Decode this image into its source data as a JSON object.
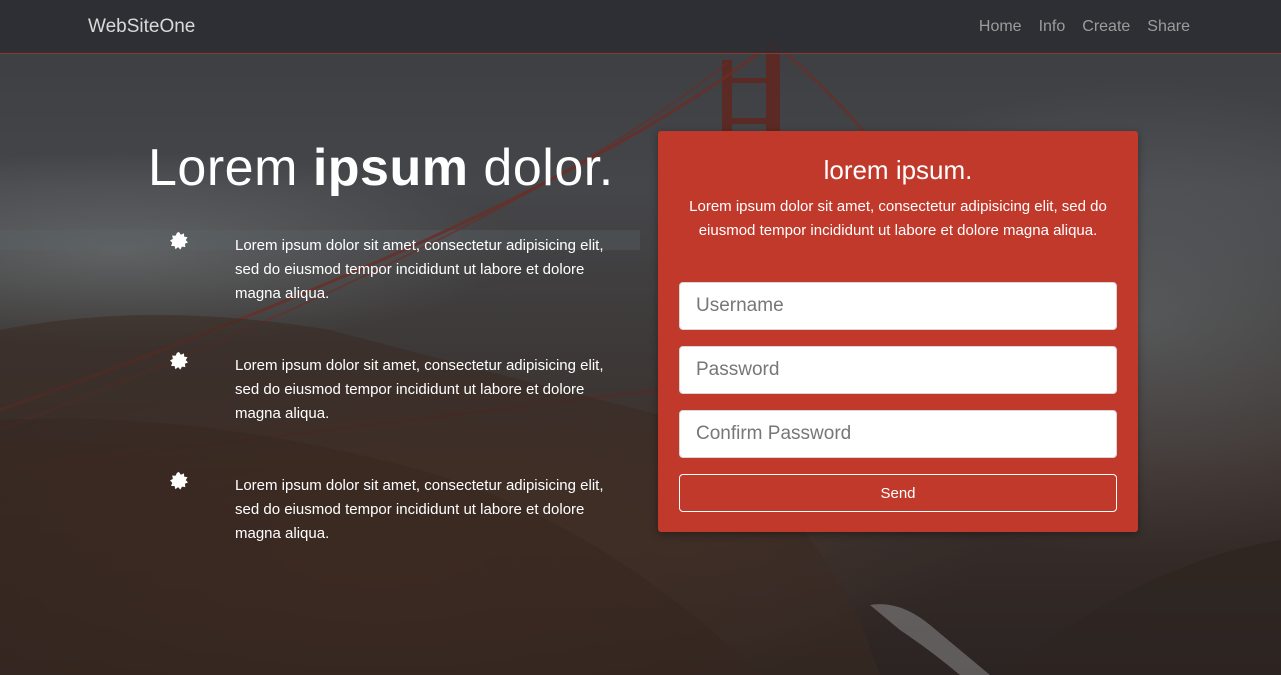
{
  "navbar": {
    "brand": "WebSiteOne",
    "links": [
      "Home",
      "Info",
      "Create",
      "Share"
    ]
  },
  "hero": {
    "title_part1": "Lorem ",
    "title_bold": "ipsum",
    "title_part2": " dolor."
  },
  "features": [
    "Lorem ipsum dolor sit amet, consectetur adipisicing elit, sed do eiusmod tempor incididunt ut labore et dolore magna aliqua.",
    "Lorem ipsum dolor sit amet, consectetur adipisicing elit, sed do eiusmod tempor incididunt ut labore et dolore magna aliqua.",
    "Lorem ipsum dolor sit amet, consectetur adipisicing elit, sed do eiusmod tempor incididunt ut labore et dolore magna aliqua."
  ],
  "form": {
    "title": "lorem ipsum.",
    "description": "Lorem ipsum dolor sit amet, consectetur adipisicing elit, sed do eiusmod tempor incididunt ut labore et dolore magna aliqua.",
    "username_placeholder": "Username",
    "password_placeholder": "Password",
    "confirm_placeholder": "Confirm Password",
    "username_value": "",
    "password_value": "",
    "confirm_value": "",
    "send_label": "Send"
  },
  "colors": {
    "accent": "#c0392b",
    "navbar": "#2c2e32",
    "nav_link": "#9c9c9c"
  },
  "icons": {
    "feature_bullet": "badge-star-icon",
    "background": "golden-gate-bridge-photo"
  }
}
